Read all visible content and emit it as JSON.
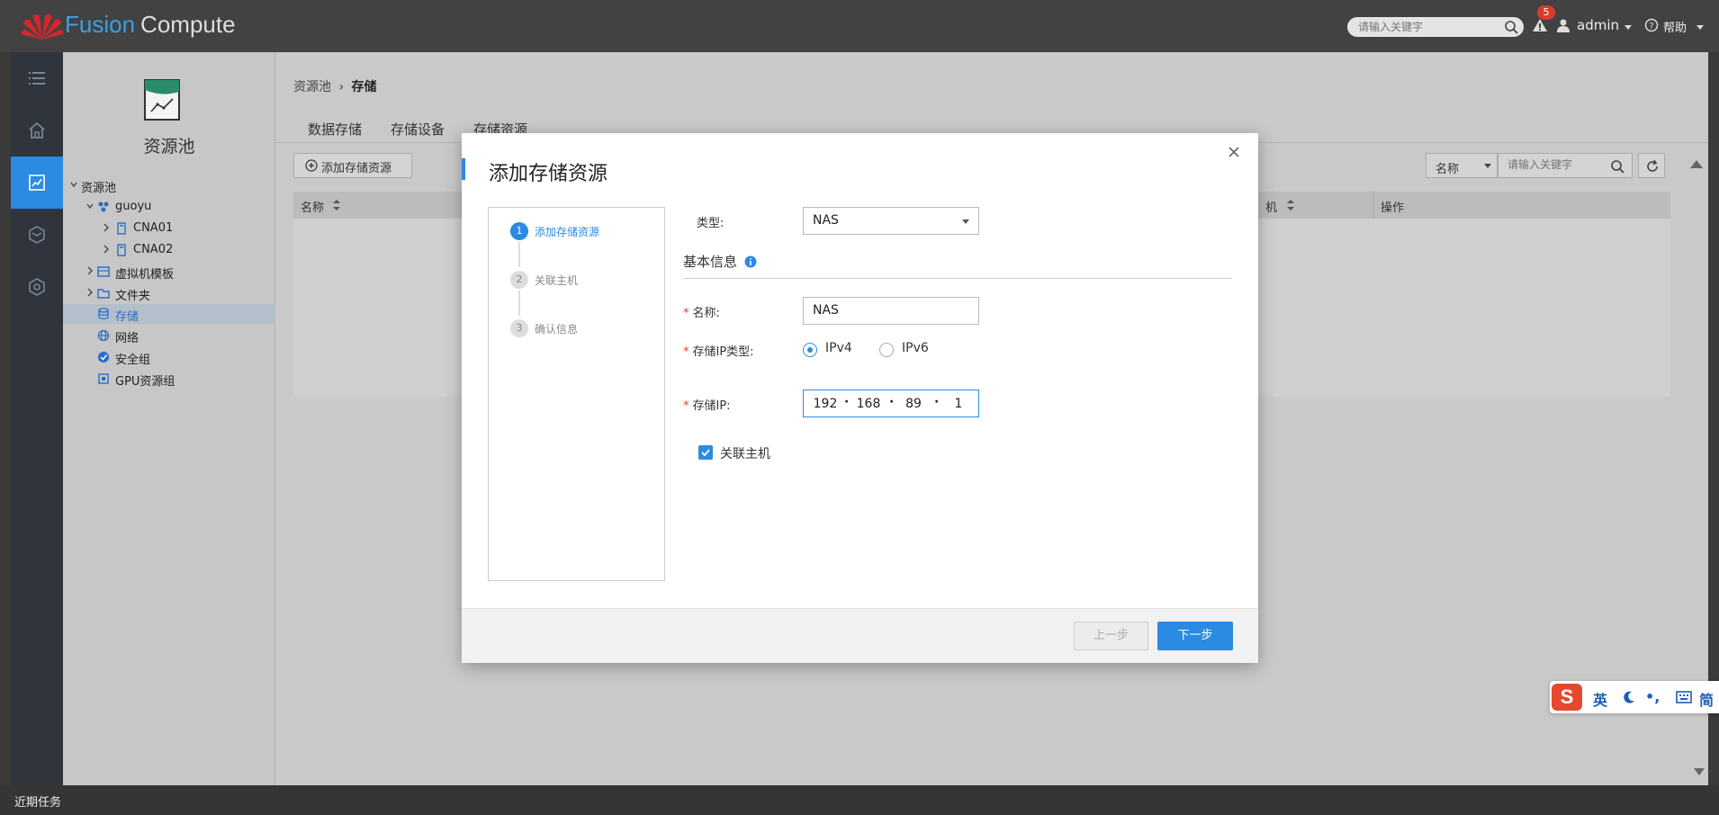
{
  "header": {
    "brand_first": "Fusion",
    "brand_second": "Compute",
    "search_placeholder": "请输入关键字",
    "alert_count": "5",
    "user": "admin",
    "help": "帮助"
  },
  "rail": {
    "items": [
      "menu-icon",
      "home-icon",
      "resource-pool-icon",
      "vm-icon",
      "settings-icon"
    ],
    "active_index": 2
  },
  "sidebar": {
    "title": "资源池",
    "tree": [
      {
        "label": "资源池",
        "level": 0,
        "expanded": true,
        "icon": "none"
      },
      {
        "label": "guoyu",
        "level": 1,
        "expanded": true,
        "icon": "cluster-icon"
      },
      {
        "label": "CNA01",
        "level": 2,
        "expanded": false,
        "icon": "host-icon"
      },
      {
        "label": "CNA02",
        "level": 2,
        "expanded": false,
        "icon": "host-icon"
      },
      {
        "label": "虚拟机模板",
        "level": 1,
        "expanded": false,
        "icon": "template-icon"
      },
      {
        "label": "文件夹",
        "level": 1,
        "expanded": false,
        "icon": "folder-icon"
      },
      {
        "label": "存储",
        "level": 1,
        "selected": true,
        "icon": "storage-icon"
      },
      {
        "label": "网络",
        "level": 1,
        "icon": "network-icon"
      },
      {
        "label": "安全组",
        "level": 1,
        "icon": "security-group-icon"
      },
      {
        "label": "GPU资源组",
        "level": 1,
        "icon": "gpu-icon"
      }
    ]
  },
  "main": {
    "breadcrumb_parent": "资源池",
    "breadcrumb_sep": "›",
    "breadcrumb_current": "存储",
    "tabs": [
      "数据存储",
      "存储设备",
      "存储资源"
    ],
    "active_tab": 2,
    "add_button": "添加存储资源",
    "filter_select": "名称",
    "filter_placeholder": "请输入关键字",
    "columns": [
      "名称",
      "机",
      "操作"
    ]
  },
  "dialog": {
    "title": "添加存储资源",
    "steps": [
      {
        "num": "1",
        "label": "添加存储资源",
        "active": true
      },
      {
        "num": "2",
        "label": "关联主机",
        "active": false
      },
      {
        "num": "3",
        "label": "确认信息",
        "active": false
      }
    ],
    "type_label": "类型:",
    "type_value": "NAS",
    "section_title": "基本信息",
    "name_label": "名称:",
    "name_value": "NAS",
    "ip_type_label": "存储IP类型:",
    "ip_type_options": [
      "IPv4",
      "IPv6"
    ],
    "ip_type_selected": "IPv4",
    "ip_label": "存储IP:",
    "ip_octets": [
      "192",
      "168",
      "89",
      "1"
    ],
    "associate_host_label": "关联主机",
    "associate_host_checked": true,
    "prev_button": "上一步",
    "next_button": "下一步"
  },
  "bottombar": {
    "label": "近期任务"
  },
  "ime": {
    "logo": "S",
    "lang": "英",
    "punct": "•,",
    "mode": "简"
  },
  "colors": {
    "accent": "#2b8ae2",
    "header_bg": "#424242",
    "required": "#e0392c",
    "badge": "#d83a2c"
  }
}
